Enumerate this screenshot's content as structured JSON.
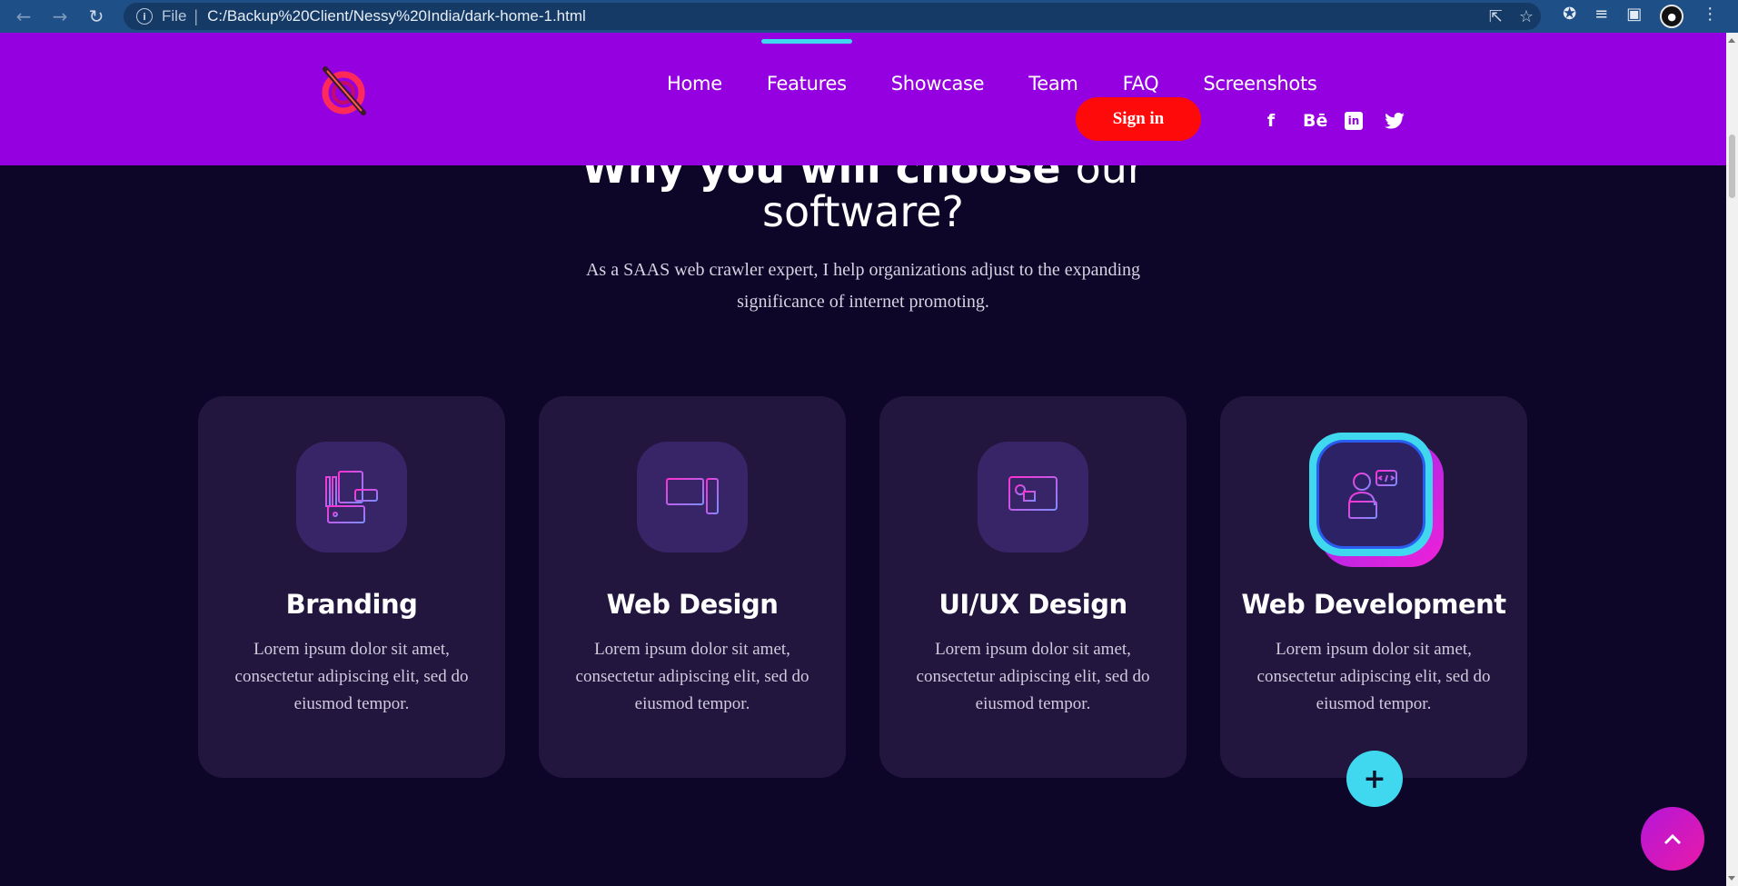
{
  "browser": {
    "back_icon": "back-arrow-icon",
    "forward_icon": "forward-arrow-icon",
    "reload_icon": "reload-icon",
    "file_label": "File",
    "url": "C:/Backup%20Client/Nessy%20India/dark-home-1.html"
  },
  "nav": {
    "items": [
      "Home",
      "Features",
      "Showcase",
      "Team",
      "FAQ",
      "Screenshots"
    ],
    "active": "Features",
    "signin_label": "Sign in",
    "social": {
      "facebook": "f",
      "behance": "Bē",
      "linkedin": "in",
      "twitter": "twitter"
    }
  },
  "section": {
    "title_bold": "Why you will choose",
    "title_light": "our",
    "title_line2": "software?",
    "lead": "As a SAAS web crawler expert, I help organizations adjust to the expanding significance of internet promoting."
  },
  "cards": [
    {
      "title": "Branding",
      "text": "Lorem ipsum dolor sit amet, consectetur adipiscing elit, sed do eiusmod tempor.",
      "icon": "branding-icon"
    },
    {
      "title": "Web Design",
      "text": "Lorem ipsum dolor sit amet, consectetur adipiscing elit, sed do eiusmod tempor.",
      "icon": "desktop-computer-icon"
    },
    {
      "title": "UI/UX Design",
      "text": "Lorem ipsum dolor sit amet, consectetur adipiscing elit, sed do eiusmod tempor.",
      "icon": "monitor-design-icon"
    },
    {
      "title": "Web Development",
      "text": "Lorem ipsum dolor sit amet, consectetur adipiscing elit, sed do eiusmod tempor.",
      "icon": "developer-laptop-icon"
    }
  ],
  "buttons": {
    "plus": "+",
    "to_top": "^"
  },
  "colors": {
    "header_bg": "#9500e0",
    "page_bg": "#0d0628",
    "card_bg": "#22163f",
    "accent_cyan": "#3fd8ee",
    "signin_red": "#ff0a0a",
    "pink": "#f021d8"
  }
}
